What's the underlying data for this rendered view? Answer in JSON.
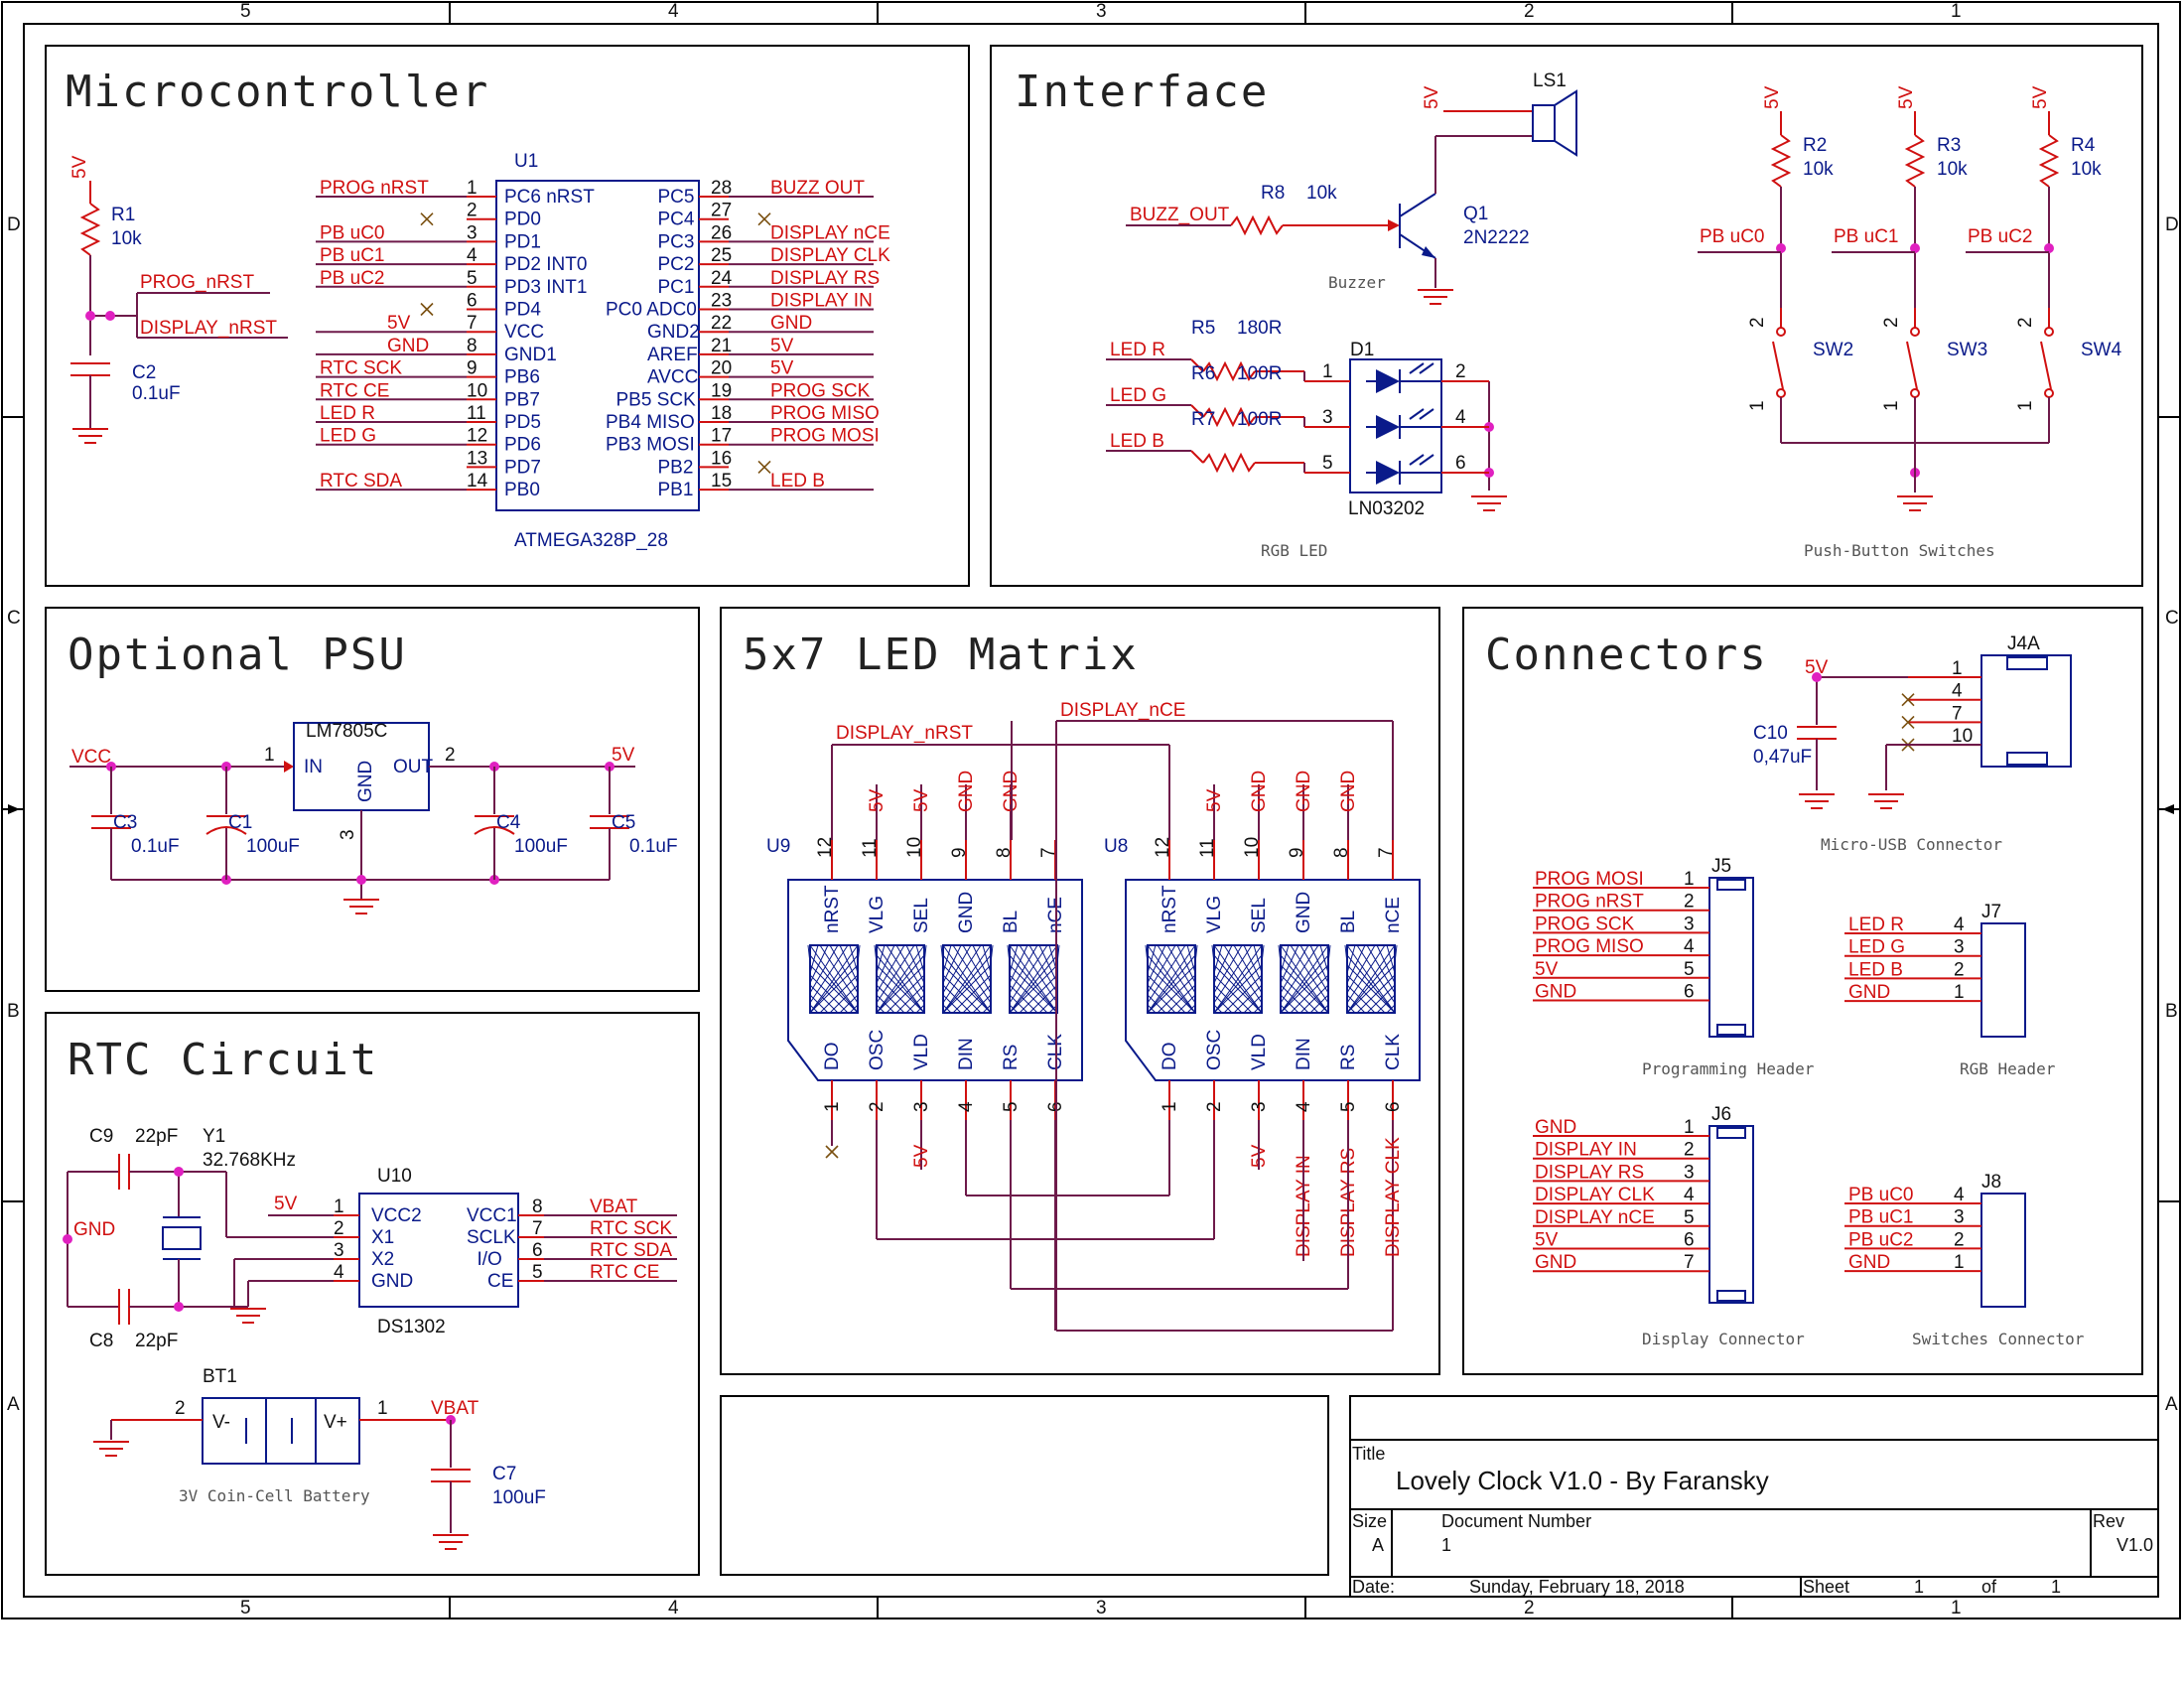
{
  "border": {
    "cols_top": [
      "5",
      "4",
      "3",
      "2",
      "1"
    ],
    "cols_bottom": [
      "5",
      "4",
      "3",
      "2",
      "1"
    ],
    "rows_left": [
      "D",
      "C",
      "B",
      "A"
    ],
    "rows_right": [
      "D",
      "C",
      "B",
      "A"
    ]
  },
  "sections": {
    "microcontroller": "Microcontroller",
    "interface": "Interface",
    "psu": "Optional PSU",
    "matrix": "5x7 LED Matrix",
    "connectors": "Connectors",
    "rtc": "RTC Circuit"
  },
  "mcu": {
    "ref": "U1",
    "part": "ATMEGA328P_28",
    "r1_ref": "R1",
    "r1_val": "10k",
    "c2_ref": "C2",
    "c2_val": "0.1uF",
    "v5": "5V",
    "nrst_net": "PROG_nRST",
    "disp_net": "DISPLAY_nRST",
    "left_pins": [
      {
        "num": "1",
        "name": "PC6_nRST",
        "net": "PROG_nRST"
      },
      {
        "num": "2",
        "name": "PD0",
        "net": ""
      },
      {
        "num": "3",
        "name": "PD1",
        "net": "PB_uC0"
      },
      {
        "num": "4",
        "name": "PD2_INT0",
        "net": "PB_uC1"
      },
      {
        "num": "5",
        "name": "PD3_INT1",
        "net": "PB_uC2"
      },
      {
        "num": "6",
        "name": "PD4",
        "net": ""
      },
      {
        "num": "7",
        "name": "VCC",
        "net": "5V"
      },
      {
        "num": "8",
        "name": "GND1",
        "net": "GND"
      },
      {
        "num": "9",
        "name": "PB6",
        "net": "RTC_SCK"
      },
      {
        "num": "10",
        "name": "PB7",
        "net": "RTC_CE"
      },
      {
        "num": "11",
        "name": "PD5",
        "net": "LED_R"
      },
      {
        "num": "12",
        "name": "PD6",
        "net": "LED_G"
      },
      {
        "num": "13",
        "name": "PD7",
        "net": ""
      },
      {
        "num": "14",
        "name": "PB0",
        "net": "RTC_SDA"
      }
    ],
    "right_pins": [
      {
        "num": "28",
        "name": "PC5",
        "net": "BUZZ_OUT"
      },
      {
        "num": "27",
        "name": "PC4",
        "net": ""
      },
      {
        "num": "26",
        "name": "PC3",
        "net": "DISPLAY_nCE"
      },
      {
        "num": "25",
        "name": "PC2",
        "net": "DISPLAY_CLK"
      },
      {
        "num": "24",
        "name": "PC1",
        "net": "DISPLAY_RS"
      },
      {
        "num": "23",
        "name": "PC0_ADC0",
        "net": "DISPLAY_IN"
      },
      {
        "num": "22",
        "name": "GND2",
        "net": "GND"
      },
      {
        "num": "21",
        "name": "AREF",
        "net": "5V"
      },
      {
        "num": "20",
        "name": "AVCC",
        "net": "5V"
      },
      {
        "num": "19",
        "name": "PB5_SCK",
        "net": "PROG_SCK"
      },
      {
        "num": "18",
        "name": "PB4_MISO",
        "net": "PROG_MISO"
      },
      {
        "num": "17",
        "name": "PB3_MOSI",
        "net": "PROG_MOSI"
      },
      {
        "num": "16",
        "name": "PB2",
        "net": ""
      },
      {
        "num": "15",
        "name": "PB1",
        "net": "LED_B"
      }
    ]
  },
  "interface": {
    "buzz_net": "BUZZ_OUT",
    "r8": "R8",
    "r8_val": "10k",
    "q1": "Q1",
    "q1_val": "2N2222",
    "ls1": "LS1",
    "v5": "5V",
    "buzzer_caption": "Buzzer",
    "rgb": [
      {
        "net": "LED_R",
        "ref": "R5",
        "val": "180R",
        "pin_in": "1",
        "pin_out": "2"
      },
      {
        "net": "LED_G",
        "ref": "R6",
        "val": "100R",
        "pin_in": "3",
        "pin_out": "4"
      },
      {
        "net": "LED_B",
        "ref": "R7",
        "val": "100R",
        "pin_in": "5",
        "pin_out": "6"
      }
    ],
    "d1": "D1",
    "d1_part": "LN03202",
    "rgb_caption": "RGB LED",
    "switches": [
      {
        "r": "R2",
        "rv": "10k",
        "net": "PB_uC0",
        "sw": "SW2"
      },
      {
        "r": "R3",
        "rv": "10k",
        "net": "PB_uC1",
        "sw": "SW3"
      },
      {
        "r": "R4",
        "rv": "10k",
        "net": "PB_uC2",
        "sw": "SW4"
      }
    ],
    "sw_pin2": "2",
    "sw_pin1": "1",
    "switch_caption": "Push-Button Switches"
  },
  "psu": {
    "vcc": "VCC",
    "v5": "5V",
    "reg": "LM7805C",
    "in": "IN",
    "out": "OUT",
    "gnd": "GND",
    "p1": "1",
    "p2": "2",
    "p3": "3",
    "caps": [
      {
        "ref": "C3",
        "val": "0.1uF"
      },
      {
        "ref": "C1",
        "val": "100uF"
      },
      {
        "ref": "C4",
        "val": "100uF"
      },
      {
        "ref": "C5",
        "val": "0.1uF"
      }
    ]
  },
  "matrix": {
    "nrst_net": "DISPLAY_nRST",
    "nce_net": "DISPLAY_nCE",
    "top_pins": [
      {
        "num": "12",
        "name": "nRST",
        "net": ""
      },
      {
        "num": "11",
        "name": "VLG",
        "net": "5V"
      },
      {
        "num": "10",
        "name": "SEL",
        "net": "5V"
      },
      {
        "num": "9",
        "name": "GND",
        "net": "GND"
      },
      {
        "num": "8",
        "name": "BL",
        "net": "GND"
      },
      {
        "num": "7",
        "name": "nCE",
        "net": ""
      }
    ],
    "top_pins_u8": [
      {
        "num": "12",
        "name": "nRST",
        "net": ""
      },
      {
        "num": "11",
        "name": "VLG",
        "net": "5V"
      },
      {
        "num": "10",
        "name": "SEL",
        "net": "GND"
      },
      {
        "num": "9",
        "name": "GND",
        "net": "GND"
      },
      {
        "num": "8",
        "name": "BL",
        "net": "GND"
      },
      {
        "num": "7",
        "name": "nCE",
        "net": ""
      }
    ],
    "bot_pins": [
      {
        "num": "1",
        "name": "DO"
      },
      {
        "num": "2",
        "name": "OSC"
      },
      {
        "num": "3",
        "name": "VLD"
      },
      {
        "num": "4",
        "name": "DIN"
      },
      {
        "num": "5",
        "name": "RS"
      },
      {
        "num": "6",
        "name": "CLK"
      }
    ],
    "u9": "U9",
    "u8": "U8",
    "u9_vld": "5V",
    "u8_nets": [
      "5V",
      "DISPLAY_IN",
      "DISPLAY_RS",
      "DISPLAY_CLK"
    ]
  },
  "connectors": {
    "j4a": "J4A",
    "j4_pins": [
      "1",
      "4",
      "7",
      "10"
    ],
    "c10": "C10",
    "c10_val": "0,47uF",
    "v5": "5V",
    "usb_caption": "Micro-USB Connector",
    "j5": "J5",
    "j5_rows": [
      {
        "net": "PROG_MOSI",
        "num": "1"
      },
      {
        "net": "PROG_nRST",
        "num": "2"
      },
      {
        "net": "PROG_SCK",
        "num": "3"
      },
      {
        "net": "PROG_MISO",
        "num": "4"
      },
      {
        "net": "5V",
        "num": "5"
      },
      {
        "net": "GND",
        "num": "6"
      }
    ],
    "prog_caption": "Programming Header",
    "j7": "J7",
    "j7_rows": [
      {
        "net": "LED_R",
        "num": "4"
      },
      {
        "net": "LED_G",
        "num": "3"
      },
      {
        "net": "LED_B",
        "num": "2"
      },
      {
        "net": "GND",
        "num": "1"
      }
    ],
    "rgb_caption": "RGB Header",
    "j6": "J6",
    "j6_rows": [
      {
        "net": "GND",
        "num": "1"
      },
      {
        "net": "DISPLAY_IN",
        "num": "2"
      },
      {
        "net": "DISPLAY_RS",
        "num": "3"
      },
      {
        "net": "DISPLAY_CLK",
        "num": "4"
      },
      {
        "net": "DISPLAY_nCE",
        "num": "5"
      },
      {
        "net": "5V",
        "num": "6"
      },
      {
        "net": "GND",
        "num": "7"
      }
    ],
    "disp_caption": "Display Connector",
    "j8": "J8",
    "j8_rows": [
      {
        "net": "PB_uC0",
        "num": "4"
      },
      {
        "net": "PB_uC1",
        "num": "3"
      },
      {
        "net": "PB_uC2",
        "num": "2"
      },
      {
        "net": "GND",
        "num": "1"
      }
    ],
    "sw_caption": "Switches Connector"
  },
  "rtc": {
    "c9": "C9",
    "c9_val": "22pF",
    "c8": "C8",
    "c8_val": "22pF",
    "y1": "Y1",
    "y1_val": "32.768KHz",
    "gnd": "GND",
    "u10": "U10",
    "u10_part": "DS1302",
    "v5": "5V",
    "left": [
      {
        "num": "1",
        "name": "VCC2"
      },
      {
        "num": "2",
        "name": "X1"
      },
      {
        "num": "3",
        "name": "X2"
      },
      {
        "num": "4",
        "name": "GND"
      }
    ],
    "right": [
      {
        "num": "8",
        "name": "VCC1",
        "net": "VBAT"
      },
      {
        "num": "7",
        "name": "SCLK",
        "net": "RTC_SCK"
      },
      {
        "num": "6",
        "name": "I/O",
        "net": "RTC_SDA"
      },
      {
        "num": "5",
        "name": "CE",
        "net": "RTC_CE"
      }
    ],
    "bt1": "BT1",
    "bt_neg": "V-",
    "bt_pos": "V+",
    "bt_p2": "2",
    "bt_p1": "1",
    "vbat": "VBAT",
    "c7": "C7",
    "c7_val": "100uF",
    "bat_caption": "3V Coin-Cell Battery"
  },
  "titleblock": {
    "title_label": "Title",
    "title": "Lovely Clock V1.0 - By Faransky",
    "size_label": "Size",
    "size": "A",
    "docnum_label": "Document Number",
    "docnum": "1",
    "rev_label": "Rev",
    "rev": "V1.0",
    "date_label": "Date:",
    "date": "Sunday, February 18, 2018",
    "sheet_label": "Sheet",
    "sheet": "1",
    "of_label": "of",
    "of": "1"
  }
}
